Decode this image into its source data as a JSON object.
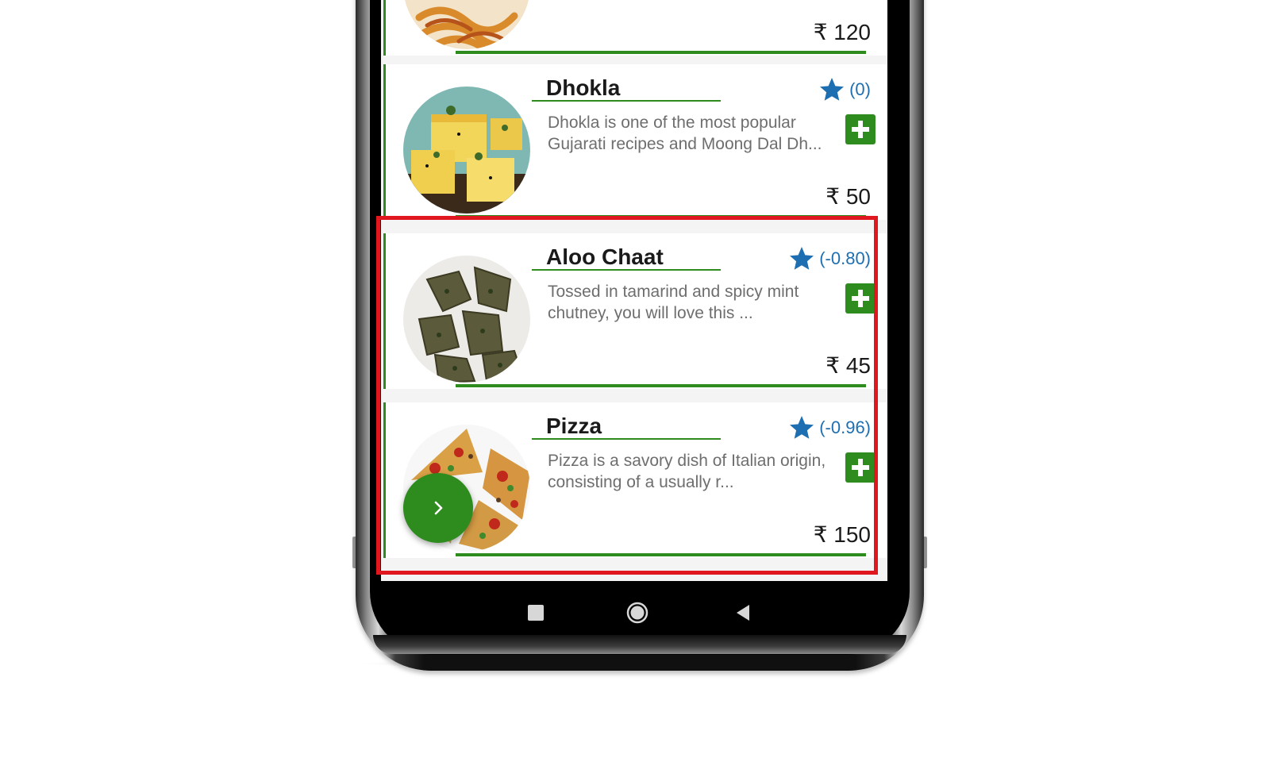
{
  "colors": {
    "accent_green": "#2e8b1e",
    "rating_blue": "#1d6fb1",
    "highlight_red": "#e0171f"
  },
  "menu": {
    "items": [
      {
        "name": "",
        "description": "",
        "rating": "",
        "price": "₹ 120",
        "image": "pasta-image"
      },
      {
        "name": "Dhokla",
        "description": "Dhokla is one of the most popular Gujarati recipes and Moong Dal Dh...",
        "rating": "(0)",
        "price": "₹ 50",
        "image": "dhokla-image"
      },
      {
        "name": "Aloo Chaat",
        "description": "Tossed in tamarind and spicy mint chutney, you will love this ...",
        "rating": "(-0.80)",
        "price": "₹ 45",
        "image": "aloo-chaat-image"
      },
      {
        "name": "Pizza",
        "description": "Pizza is a savory dish of Italian origin, consisting of a usually r...",
        "rating": "(-0.96)",
        "price": "₹ 150",
        "image": "pizza-image"
      }
    ]
  },
  "fab": {
    "icon": "chevron-right-icon"
  },
  "navbar": {
    "recents_icon": "square-recents-icon",
    "home_icon": "circle-home-icon",
    "back_icon": "triangle-back-icon"
  }
}
